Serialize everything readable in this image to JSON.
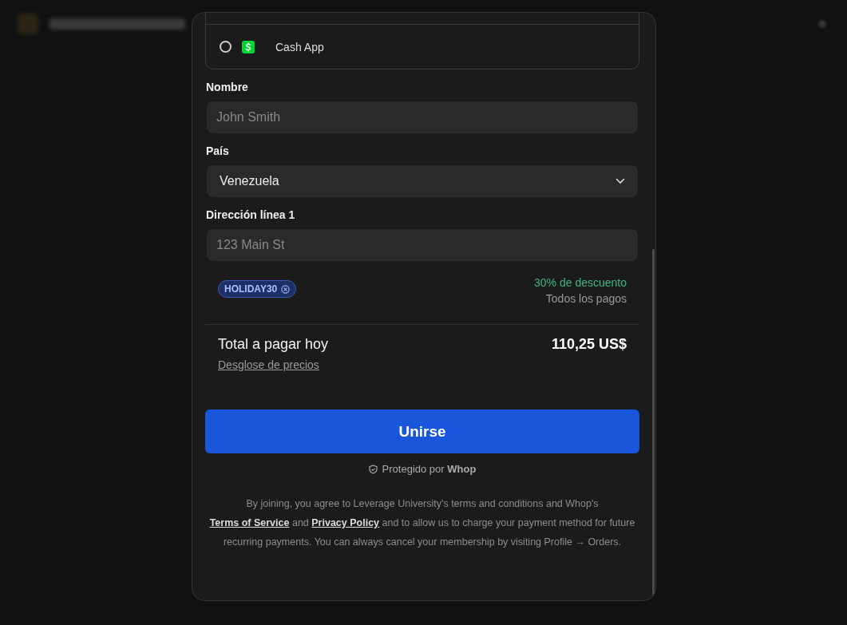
{
  "payment_methods": [
    {
      "label": "Cash App",
      "selected": false
    }
  ],
  "fields": [
    {
      "label": "Nombre",
      "kind": "text",
      "placeholder": "John Smith"
    },
    {
      "label": "País",
      "kind": "select",
      "value": "Venezuela"
    },
    {
      "label": "Dirección línea 1",
      "kind": "text",
      "placeholder": "123 Main St"
    }
  ],
  "coupon": {
    "code": "HOLIDAY30",
    "discount": "30% de descuento",
    "scope": "Todos los pagos"
  },
  "total": {
    "label": "Total a pagar hoy",
    "amount": "110,25 US$",
    "breakdown_link": "Desglose de precios"
  },
  "join_button": "Unirse",
  "protected_by": "Protegido por **Whop**",
  "terms": [
    {
      "kind": "text",
      "text": "By joining, you agree to Leverage University's terms and conditions and Whop's "
    },
    {
      "kind": "link",
      "text": "Terms of Service"
    },
    {
      "kind": "text",
      "text": " and "
    },
    {
      "kind": "link",
      "text": "Privacy Policy"
    },
    {
      "kind": "text",
      "text": " and to allow us to charge your payment method for future recurring payments. You can always cancel your membership by visiting Profile → Orders."
    }
  ]
}
